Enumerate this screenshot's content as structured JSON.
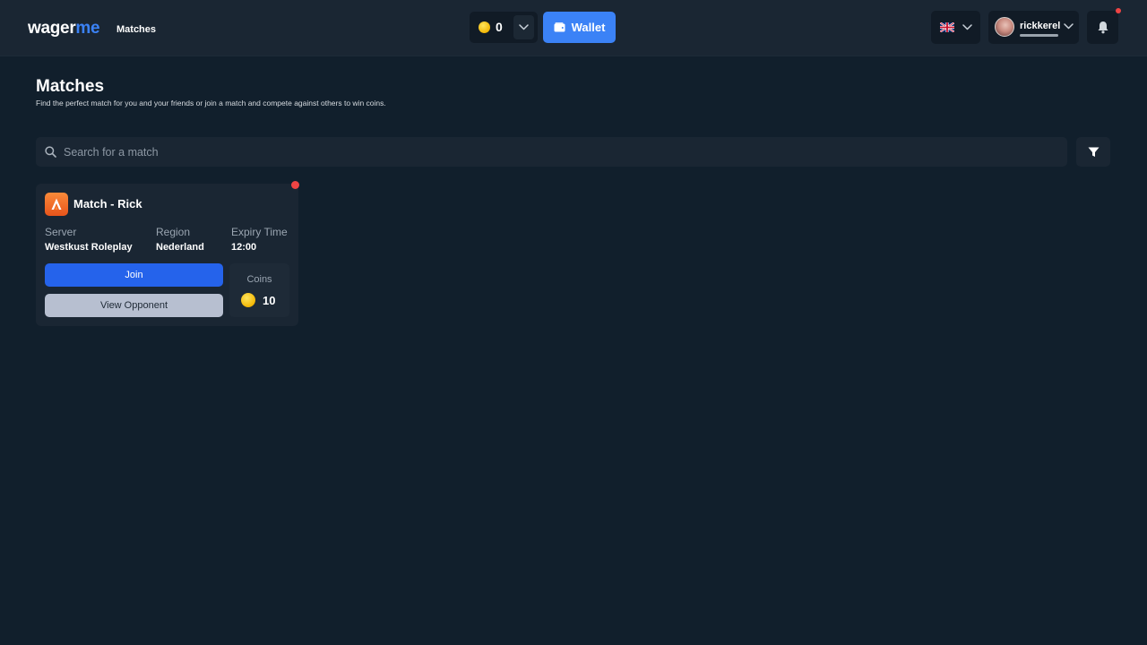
{
  "header": {
    "logo_part1": "wager",
    "logo_part2": "me",
    "nav": {
      "matches": "Matches"
    },
    "balance": "0",
    "wallet_label": "Wallet",
    "username": "rickkerel"
  },
  "page": {
    "title": "Matches",
    "subtitle": "Find the perfect match for you and your friends or join a match and compete against others to win coins."
  },
  "search": {
    "placeholder": "Search for a match"
  },
  "match_card": {
    "title": "Match - Rick",
    "server_label": "Server",
    "server_value": "Westkust Roleplay",
    "region_label": "Region",
    "region_value": "Nederland",
    "expiry_label": "Expiry Time",
    "expiry_value": "12:00",
    "join_label": "Join",
    "view_label": "View Opponent",
    "coins_label": "Coins",
    "coins_value": "10"
  },
  "colors": {
    "background": "#111f2c",
    "header": "#1a2633",
    "accent": "#3b82f6",
    "join": "#2563eb",
    "notification": "#ef4444",
    "coin": "#f2b705"
  }
}
